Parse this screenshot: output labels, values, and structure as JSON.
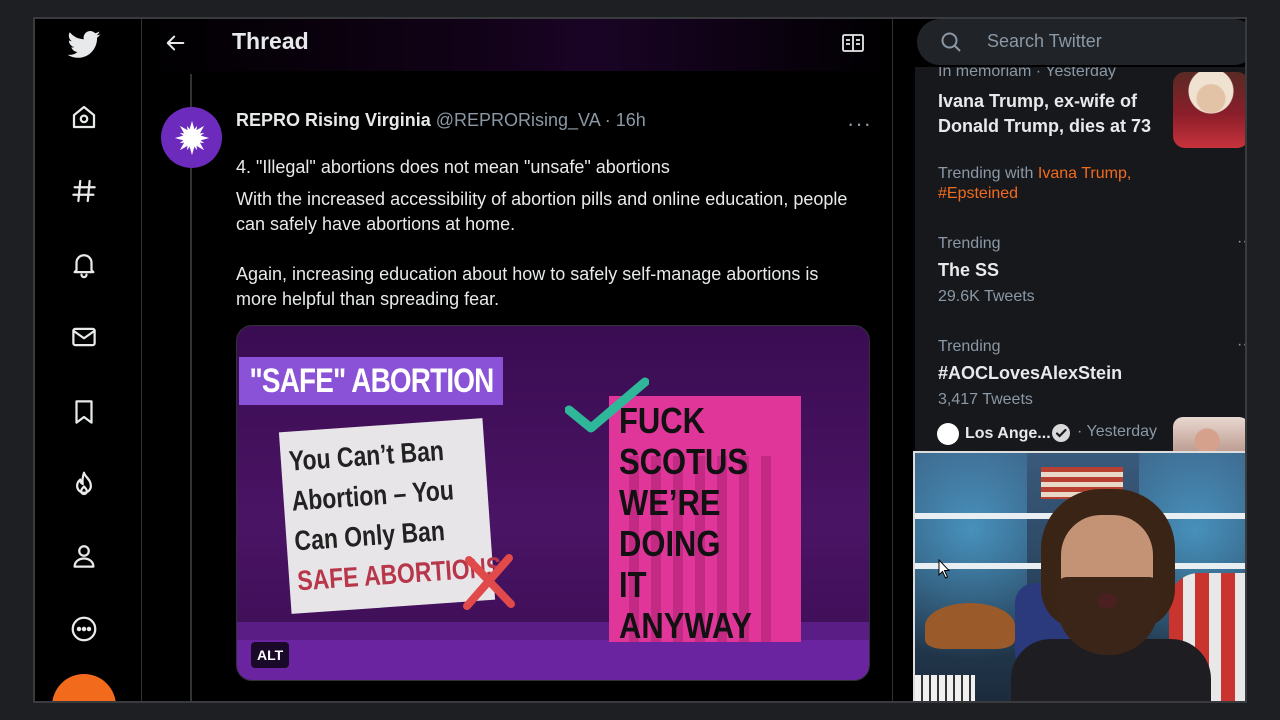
{
  "header": {
    "title": "Thread"
  },
  "search": {
    "placeholder": "Search Twitter"
  },
  "tweet": {
    "author_name": "REPRO Rising Virginia",
    "handle": "@REPRORising_VA",
    "separator": "·",
    "time": "16h",
    "more": "···",
    "paragraph_1": "4. \"Illegal\" abortions does not mean \"unsafe\" abortions",
    "paragraph_2": "With the increased accessibility of abortion pills and online education, people can safely have abortions at home.",
    "paragraph_3": "Again, increasing education about how to safely self-manage abortions is more helpful than spreading fear.",
    "media": {
      "banner": "\"SAFE\" ABORTION",
      "sign_lines": [
        "You Can’t Ban",
        "Abortion – You",
        "Can Only Ban"
      ],
      "sign_red_line": "SAFE ABORTIONS",
      "pink_lines": [
        "FUCK",
        "SCOTUS",
        "WE’RE",
        "DOING",
        "IT",
        "ANYWAY"
      ],
      "alt_badge": "ALT"
    }
  },
  "trends": [
    {
      "meta": "In memoriam · Yesterday",
      "title": "Ivana Trump, ex-wife of Donald Trump, dies at 73",
      "trending_with_label": "Trending with",
      "trending_with_1": "Ivana Trump,",
      "trending_with_2": "#Epsteined"
    },
    {
      "meta": "Trending",
      "title": "The SS",
      "count": "29.6K Tweets"
    },
    {
      "meta": "Trending",
      "title": "#AOCLovesAlexStein",
      "count": "3,417 Tweets"
    }
  ],
  "news": {
    "source": "Los Ange...",
    "time": "· Yesterday"
  },
  "colors": {
    "accent": "#f26b1d",
    "background": "#000000",
    "panel": "#16181c",
    "muted": "#8b98a5"
  },
  "icons": {
    "nav": [
      "twitter-logo-icon",
      "home-icon",
      "hashtag-icon",
      "bell-icon",
      "mail-icon",
      "bookmark-icon",
      "fire-icon",
      "profile-icon",
      "more-circle-icon"
    ]
  }
}
